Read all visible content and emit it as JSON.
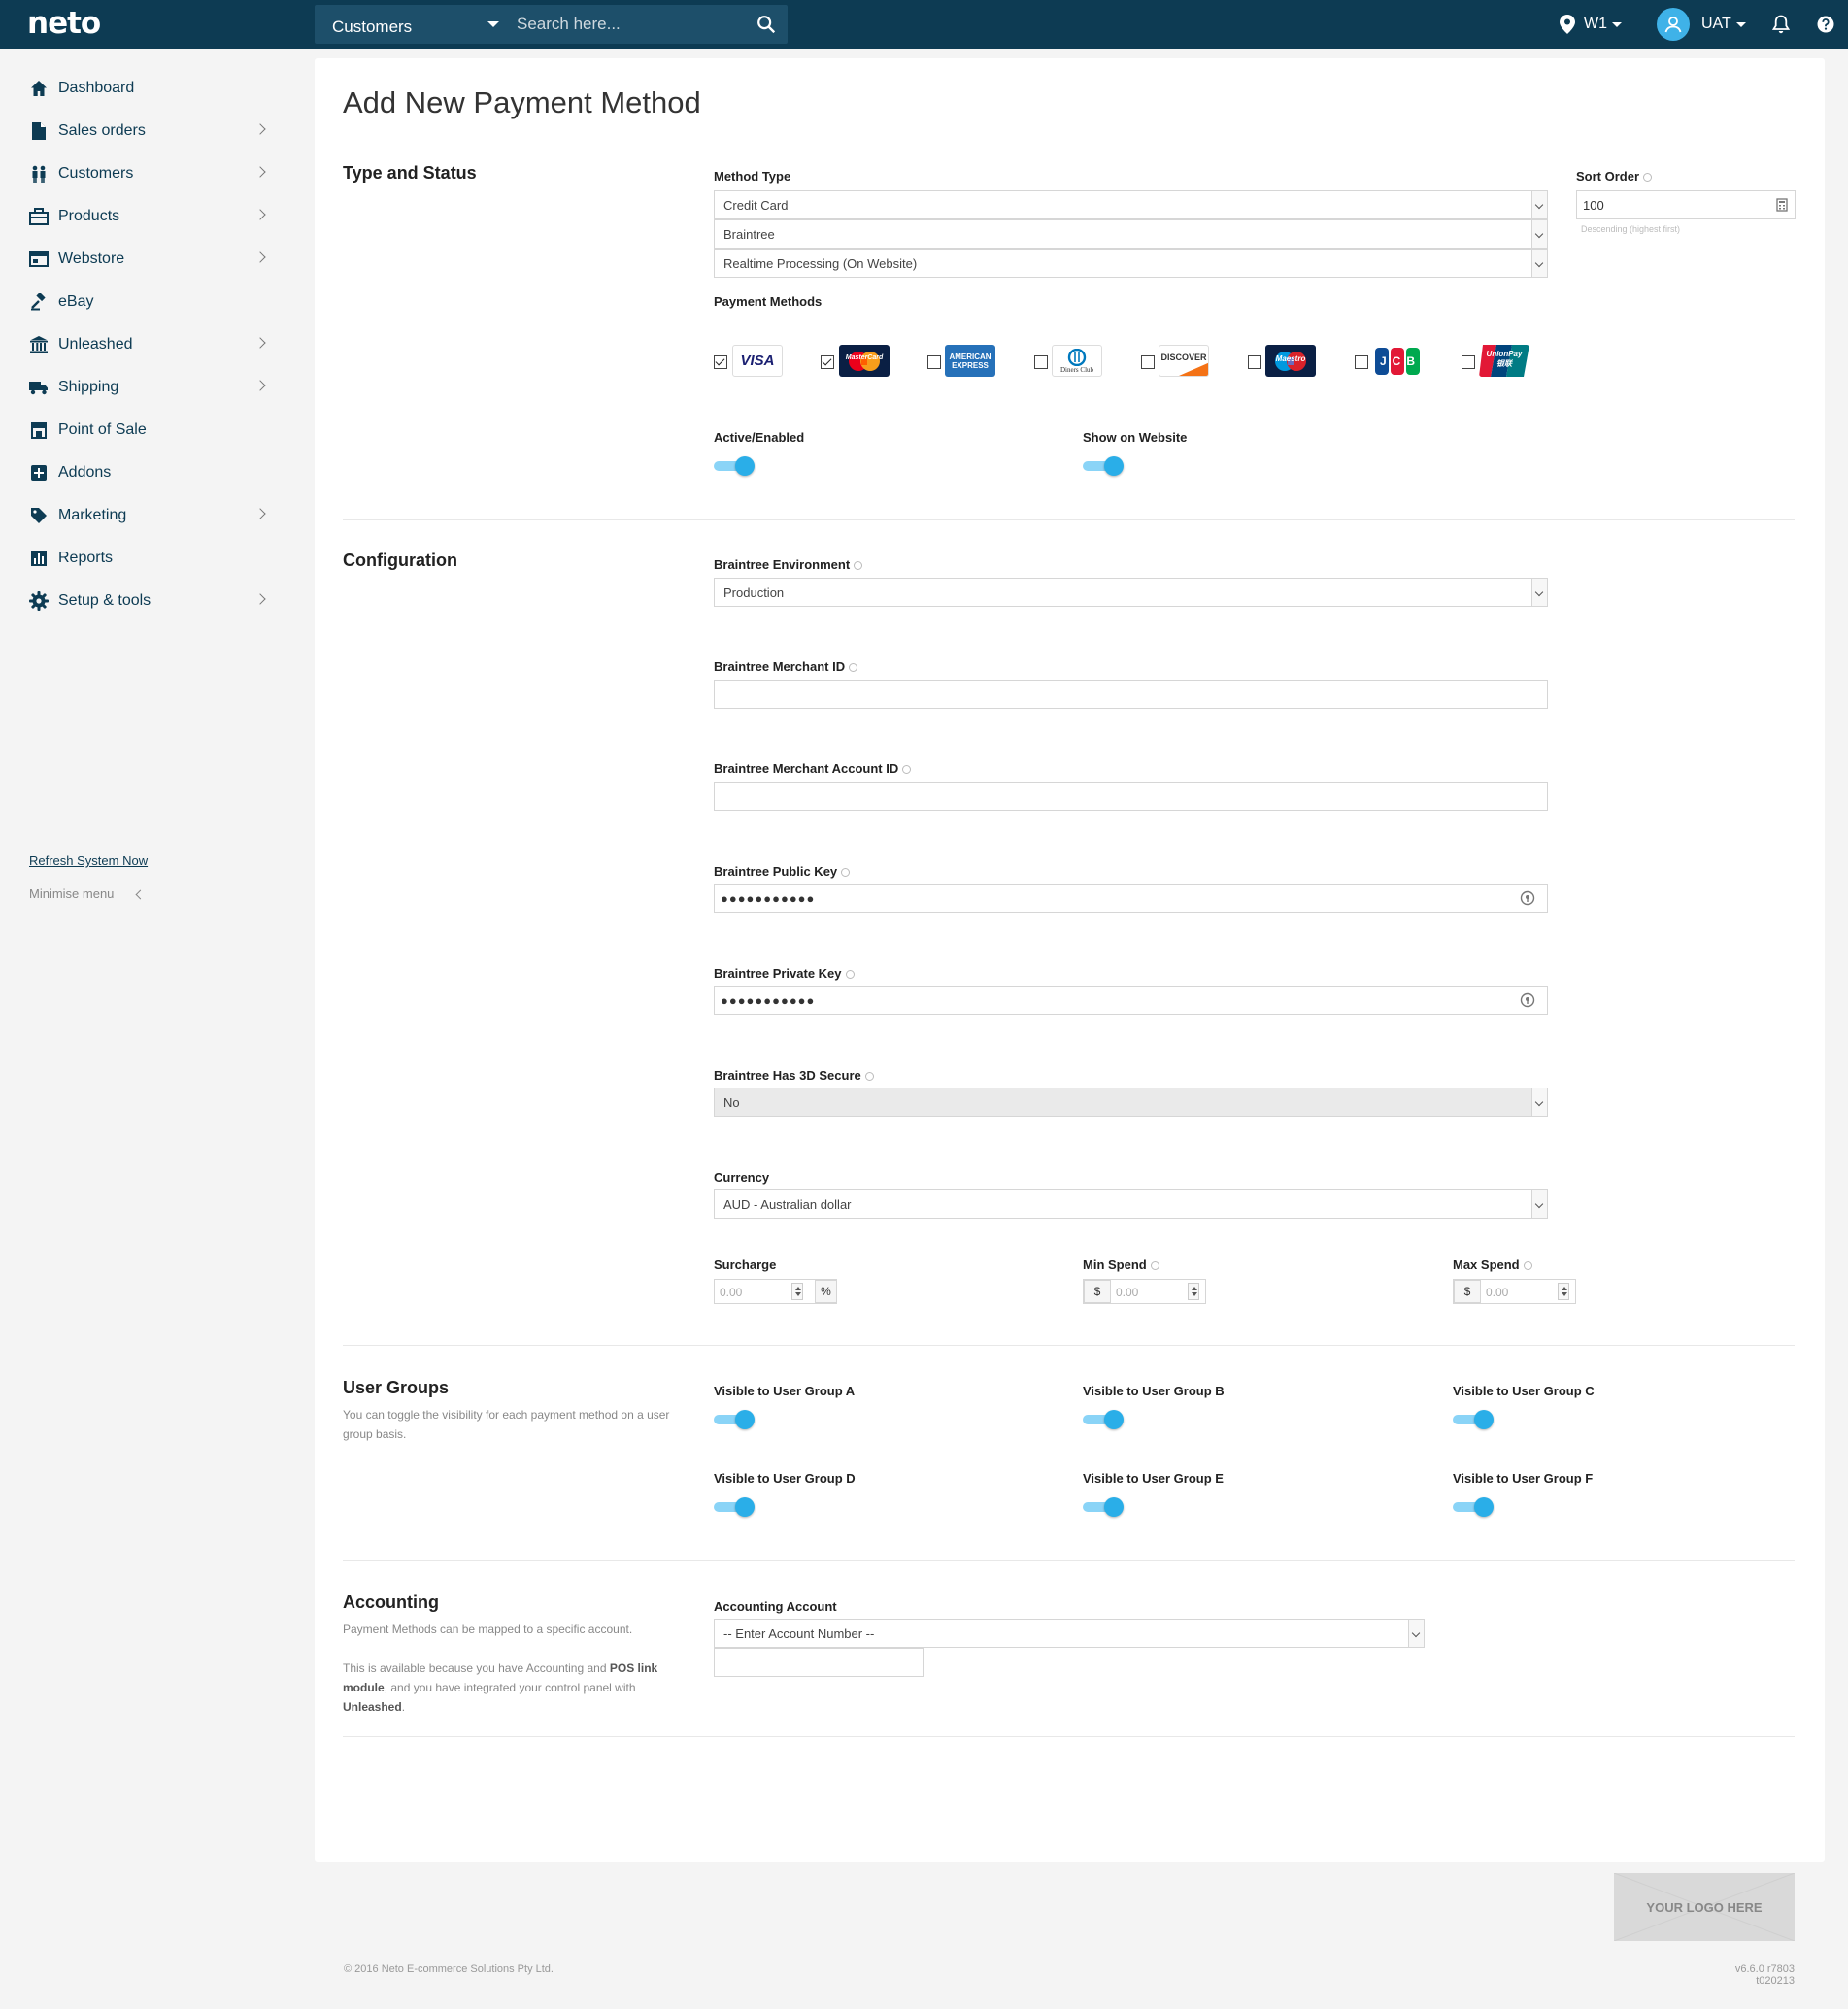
{
  "topbar": {
    "logo": "neto",
    "search_scope": "Customers",
    "search_placeholder": "Search here...",
    "location": "W1",
    "user": "UAT"
  },
  "sidebar": {
    "items": [
      {
        "label": "Dashboard",
        "icon": "home-icon",
        "has_children": false
      },
      {
        "label": "Sales orders",
        "icon": "document-icon",
        "has_children": true
      },
      {
        "label": "Customers",
        "icon": "people-icon",
        "has_children": true
      },
      {
        "label": "Products",
        "icon": "box-icon",
        "has_children": true
      },
      {
        "label": "Webstore",
        "icon": "browser-icon",
        "has_children": true
      },
      {
        "label": "eBay",
        "icon": "gavel-icon",
        "has_children": false
      },
      {
        "label": "Unleashed",
        "icon": "bank-icon",
        "has_children": true
      },
      {
        "label": "Shipping",
        "icon": "truck-icon",
        "has_children": true
      },
      {
        "label": "Point of Sale",
        "icon": "store-icon",
        "has_children": false
      },
      {
        "label": "Addons",
        "icon": "plus-square-icon",
        "has_children": false
      },
      {
        "label": "Marketing",
        "icon": "tag-icon",
        "has_children": true
      },
      {
        "label": "Reports",
        "icon": "bar-chart-icon",
        "has_children": false
      },
      {
        "label": "Setup & tools",
        "icon": "gear-icon",
        "has_children": true
      }
    ],
    "refresh_label": "Refresh System Now",
    "minimise_label": "Minimise menu"
  },
  "page": {
    "title": "Add New Payment Method"
  },
  "type_status": {
    "title": "Type and Status",
    "method_type_label": "Method Type",
    "method_type": "Credit Card",
    "provider": "Braintree",
    "processing": "Realtime Processing (On Website)",
    "sort_order_label": "Sort Order",
    "sort_order": "100",
    "sort_order_hint": "Descending (highest first)",
    "payment_methods_label": "Payment Methods",
    "cards": [
      {
        "name": "VISA",
        "checked": true
      },
      {
        "name": "MasterCard",
        "checked": true
      },
      {
        "name": "AMERICAN EXPRESS",
        "checked": false
      },
      {
        "name": "Diners Club",
        "checked": false
      },
      {
        "name": "DISCOVER",
        "checked": false
      },
      {
        "name": "Maestro",
        "checked": false
      },
      {
        "name": "JCB",
        "checked": false
      },
      {
        "name": "UnionPay 银联",
        "checked": false
      }
    ],
    "active_label": "Active/Enabled",
    "active": true,
    "show_website_label": "Show on Website",
    "show_website": true
  },
  "configuration": {
    "title": "Configuration",
    "environment_label": "Braintree Environment",
    "environment": "Production",
    "merchant_id_label": "Braintree Merchant ID",
    "merchant_id": "",
    "merchant_account_id_label": "Braintree Merchant Account ID",
    "merchant_account_id": "",
    "public_key_label": "Braintree Public Key",
    "public_key": "●●●●●●●●●●●",
    "private_key_label": "Braintree Private Key",
    "private_key": "●●●●●●●●●●●",
    "secure3d_label": "Braintree Has 3D Secure",
    "secure3d": "No",
    "currency_label": "Currency",
    "currency": "AUD - Australian dollar",
    "surcharge_label": "Surcharge",
    "surcharge": "0.00",
    "surcharge_unit": "%",
    "min_spend_label": "Min Spend",
    "min_spend": "0.00",
    "max_spend_label": "Max Spend",
    "max_spend": "0.00",
    "currency_symbol": "$"
  },
  "user_groups": {
    "title": "User Groups",
    "description": "You can toggle the visibility for each payment method on a user group basis.",
    "groups": [
      {
        "label": "Visible to User Group A",
        "enabled": true
      },
      {
        "label": "Visible to User Group B",
        "enabled": true
      },
      {
        "label": "Visible to User Group C",
        "enabled": true
      },
      {
        "label": "Visible to User Group D",
        "enabled": true
      },
      {
        "label": "Visible to User Group E",
        "enabled": true
      },
      {
        "label": "Visible to User Group F",
        "enabled": true
      }
    ]
  },
  "accounting": {
    "title": "Accounting",
    "description1": "Payment Methods can be mapped to a specific account.",
    "desc2_a": "This is available because you have Accounting and ",
    "desc2_b": "POS link module",
    "desc2_c": ", and you have integrated your control panel with ",
    "desc2_d": "Unleashed",
    "desc2_e": ".",
    "account_label": "Accounting Account",
    "account_placeholder": "-- Enter Account Number --",
    "account_extra": ""
  },
  "footer": {
    "logo_placeholder": "YOUR LOGO HERE",
    "copyright": "© 2016 Neto E-commerce Solutions Pty Ltd.",
    "version": "v6.6.0 r7803 t020213"
  },
  "colors": {
    "topbar": "#0d3b53",
    "accent": "#2aaee8"
  }
}
